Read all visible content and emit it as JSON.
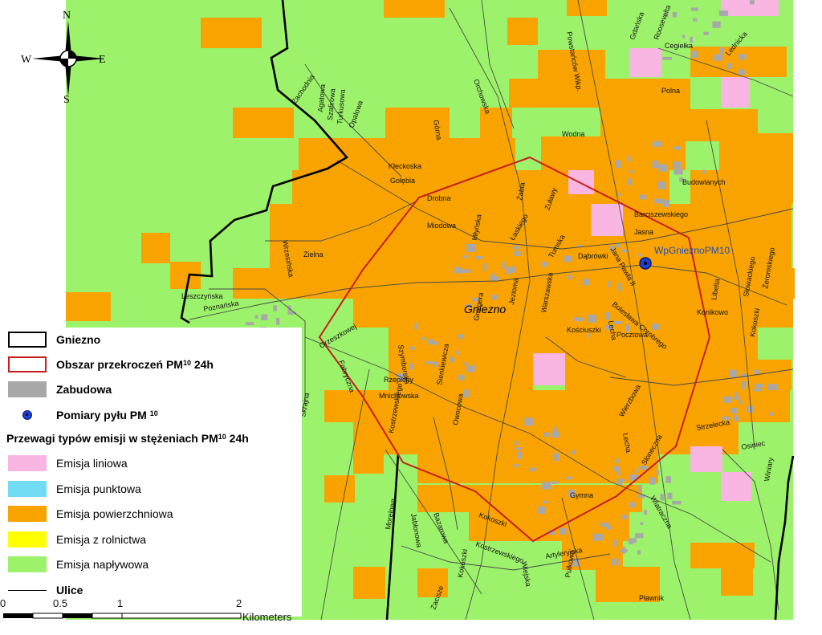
{
  "compass": {
    "n": "N",
    "s": "S",
    "e": "E",
    "w": "W"
  },
  "city_label": "Gniezno",
  "station_label": "WpGnieznoPM10",
  "legend": {
    "boundary": "Gniezno",
    "exceed_prefix": "Obszar przekroczeń PM",
    "exceed_sub": "10",
    "exceed_suffix": " 24h",
    "buildings": "Zabudowa",
    "measure_prefix": "Pomiary pyłu PM ",
    "measure_sub": "10",
    "emission_head_prefix": "Przewagi typów emisji w stężeniach PM",
    "emission_head_sub": "10",
    "emission_head_suffix": " 24h",
    "classes": [
      {
        "label": "Emisja liniowa",
        "color": "#f9b6e2"
      },
      {
        "label": "Emisja punktowa",
        "color": "#73dcf5"
      },
      {
        "label": "Emisja powierzchniowa",
        "color": "#f9a300"
      },
      {
        "label": "Emisja z rolnictwa",
        "color": "#ffff00"
      },
      {
        "label": "Emisja napływowa",
        "color": "#9cf26a"
      }
    ],
    "streets": "Ulice"
  },
  "scale": {
    "ticks": [
      "0",
      "0.5",
      "1",
      "2"
    ],
    "unit": "Kilometers"
  },
  "colors": {
    "background": "#9cf26a",
    "surface": "#f9a300",
    "linear": "#f9b6e2",
    "boundary": "#000000",
    "exceedance": "#c81e1e",
    "buildings": "#a8a8a8",
    "streets": "#4a4a4a"
  },
  "streets": [
    "Zachodnia",
    "Agatowa",
    "Szafirowa",
    "Turkusowa",
    "Opalowa",
    "Kłeckoska",
    "Gołębia",
    "Drobna",
    "Górna",
    "Żabia",
    "Zuławy",
    "Łaskiego",
    "Miodowa",
    "Młyńska",
    "Jezioma",
    "Tumska",
    "Dąbrówki",
    "Jana Pawła II",
    "Bolesława Chrobrego",
    "Lecha",
    "Kościuszki",
    "Pocztowa",
    "Warszawska",
    "Konikowo",
    "Libelta",
    "Słowackiego",
    "Żeromskiego",
    "Budowlanych",
    "Barciszewskiego",
    "Jasna",
    "Wodna",
    "Zielna",
    "Wrzesińska",
    "Poznańska",
    "Leszczyńska",
    "Orzeszkowej",
    "Szymborska",
    "Rzepichy",
    "Mnichowska",
    "Sienkiewicza",
    "Fabryczna",
    "Słoneczna",
    "Wierzbowa",
    "Wiatraczna",
    "Kokoszki",
    "Kostrzewskiego",
    "Artyleryjska",
    "Gymna",
    "Wiejska",
    "Pułkowa",
    "Pławnik",
    "Strzelecka",
    "Osiniec",
    "Lecha",
    "Owocowa",
    "Zacisze",
    "Kokoszki",
    "Bazarowa",
    "Jabłonowa",
    "Morelowa",
    "Gdańska",
    "Roosevelta",
    "Kostrzewskiego",
    "Skrajna",
    "Cegiełka",
    "Lednicka",
    "Orchowska",
    "Powstańców Wlkp.",
    "Polna",
    "Winiary",
    "Grotgera",
    "Kokoszki"
  ]
}
